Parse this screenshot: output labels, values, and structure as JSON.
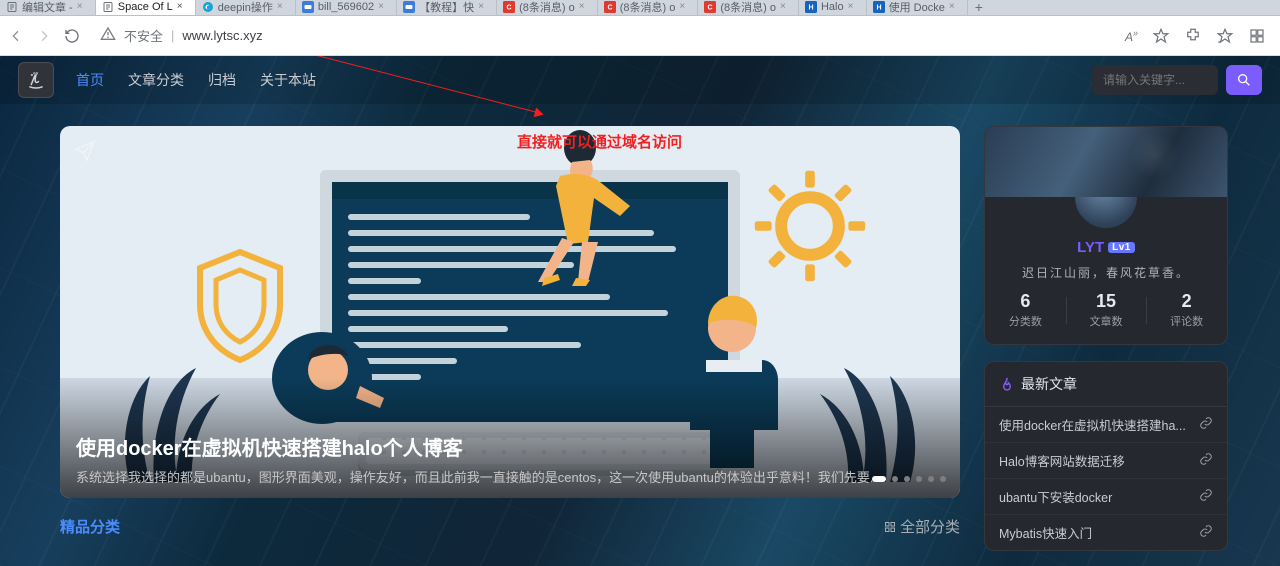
{
  "tabs": [
    {
      "title": "编辑文章 -",
      "fav": "page"
    },
    {
      "title": "Space Of L",
      "fav": "page",
      "active": true
    },
    {
      "title": "deepin操作",
      "fav": "deepin"
    },
    {
      "title": "bill_569602",
      "fav": "csdn"
    },
    {
      "title": "【教程】快",
      "fav": "csdn"
    },
    {
      "title": "(8条消息) o",
      "fav": "c"
    },
    {
      "title": "(8条消息) o",
      "fav": "c"
    },
    {
      "title": "(8条消息) o",
      "fav": "c"
    },
    {
      "title": "Halo",
      "fav": "h"
    },
    {
      "title": "使用 Docke",
      "fav": "h"
    }
  ],
  "addressbar": {
    "insecure": "不安全",
    "domain": "www.lytsc.xyz"
  },
  "annotation": "直接就可以通过域名访问",
  "nav": {
    "items": [
      "首页",
      "文章分类",
      "归档",
      "关于本站"
    ],
    "active": 0
  },
  "search": {
    "placeholder": "请输入关键字..."
  },
  "hero": {
    "title": "使用docker在虚拟机快速搭建halo个人博客",
    "desc": "系统选择我选择的都是ubantu，图形界面美观，操作友好，而且此前我一直接触的是centos，这一次使用ubantu的体验出乎意料！我们先要..."
  },
  "featured": {
    "title": "精品分类",
    "all": "全部分类"
  },
  "profile": {
    "name": "LYT",
    "level": "Lv1",
    "tagline": "迟日江山丽，春风花草香。",
    "stats": [
      {
        "n": "6",
        "l": "分类数"
      },
      {
        "n": "15",
        "l": "文章数"
      },
      {
        "n": "2",
        "l": "评论数"
      }
    ]
  },
  "latest": {
    "title": "最新文章",
    "items": [
      "使用docker在虚拟机快速搭建ha...",
      "Halo博客网站数据迁移",
      "ubantu下安装docker",
      "Mybatis快速入门"
    ]
  }
}
